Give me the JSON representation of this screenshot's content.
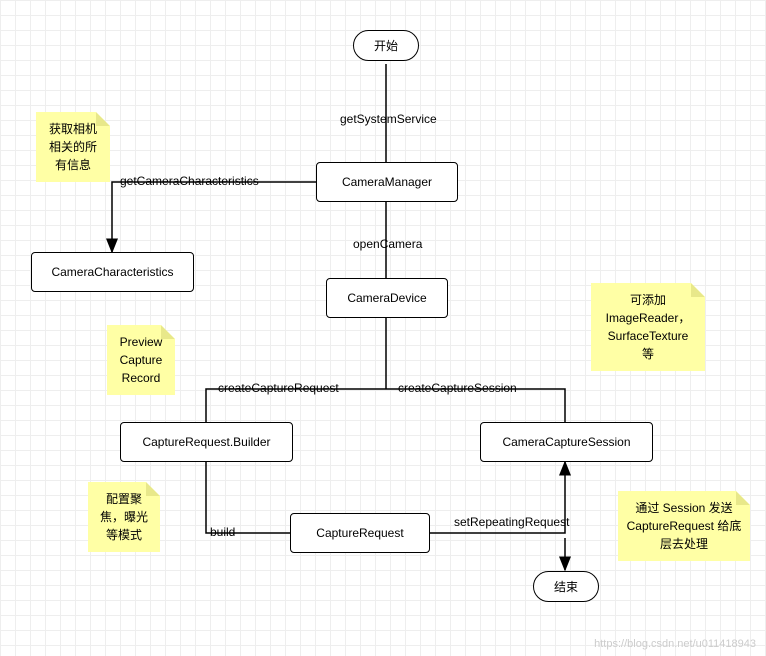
{
  "nodes": {
    "start": "开始",
    "manager": "CameraManager",
    "characteristics": "CameraCharacteristics",
    "device": "CameraDevice",
    "builder": "CaptureRequest.Builder",
    "request": "CaptureRequest",
    "session": "CameraCaptureSession",
    "end": "结束"
  },
  "edges": {
    "getSystemService": "getSystemService",
    "getCameraCharacteristics": "getCameraCharacteristics",
    "openCamera": "openCamera",
    "createCaptureRequest": "createCaptureRequest",
    "createCaptureSession": "createCaptureSession",
    "build": "build",
    "setRepeatingRequest": "setRepeatingRequest"
  },
  "notes": {
    "cameraInfo": "获取相机相关的所有信息",
    "previewCaptureRecord": "Preview\nCapture\nRecord",
    "surfaceNote": "可添加\nImageReader，\nSurfaceTexture\n等",
    "focusNote": "配置聚焦，曝光等模式",
    "sessionNote": "通过 Session 发送 CaptureRequest 给底层去处理"
  },
  "watermark": "https://blog.csdn.net/u011418943"
}
